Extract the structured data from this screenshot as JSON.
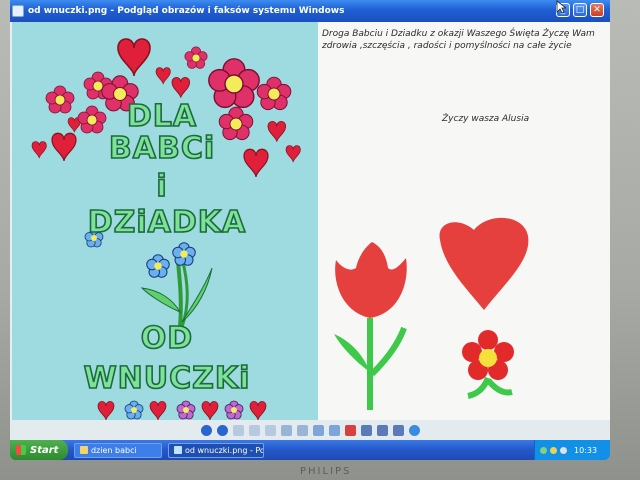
{
  "window": {
    "title": "od wnuczki.png - Podgląd obrazów i faksów systemu Windows",
    "minimize_icon": "minimize-icon",
    "maximize_icon": "maximize-icon",
    "close_icon": "close-icon"
  },
  "left_picture": {
    "line1": "DLA",
    "line2": "BABCi",
    "line3": "i",
    "line4": "DZiADKA",
    "line5": "OD",
    "line6": "WNUCZKi"
  },
  "right_picture": {
    "message": "Droga Babciu i Dziadku z okazji Waszego Święta Życzę Wam zdrowia ,szczęścia , radości i  pomyślności na całe życie",
    "signature": "Życzy wasza Alusia"
  },
  "toolbar": {
    "icons": [
      "previous-image-icon",
      "next-image-icon",
      "best-fit-icon",
      "actual-size-icon",
      "slideshow-icon",
      "zoom-in-icon",
      "zoom-out-icon",
      "rotate-clockwise-icon",
      "rotate-counterclockwise-icon",
      "delete-icon",
      "print-icon",
      "copy-to-icon",
      "edit-icon",
      "help-icon"
    ]
  },
  "taskbar": {
    "start_label": "Start",
    "tasks": [
      {
        "label": "dzien babci",
        "active": false
      },
      {
        "label": "od wnuczki.png - Podg...",
        "active": true
      }
    ],
    "clock": "10:33"
  },
  "monitor_brand": "PHILIPS",
  "colors": {
    "titlebar": "#1f5fd4",
    "left_bg": "#9ddbe0",
    "heart": "#e0203a",
    "flower": "#e0306a",
    "green_text": "#7ee09a"
  }
}
